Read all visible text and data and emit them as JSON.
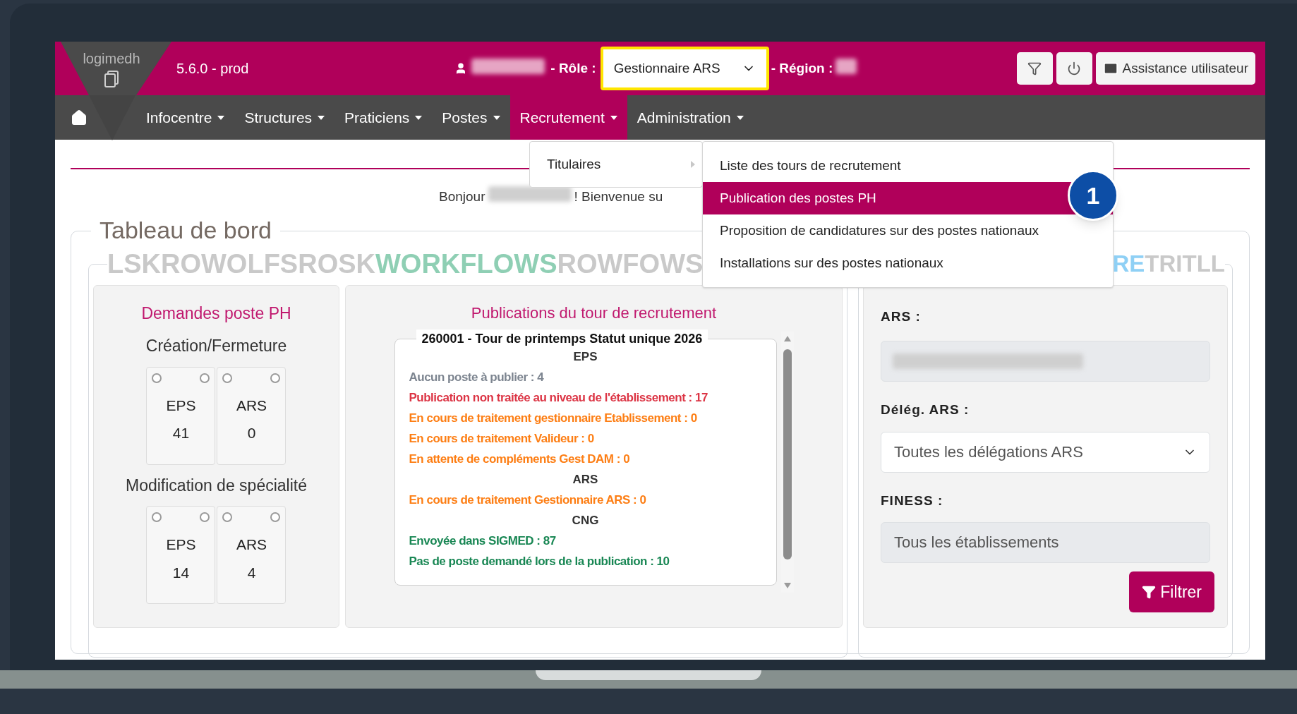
{
  "header": {
    "logo": "logimedh",
    "version": "5.6.0 - prod",
    "role_label": "- Rôle :",
    "role": "Gestionnaire ARS",
    "region_label": "- Région :",
    "support_button": "Assistance utilisateur"
  },
  "nav": [
    {
      "label": "Infocentre",
      "selected": false
    },
    {
      "label": "Structures",
      "selected": false
    },
    {
      "label": "Praticiens",
      "selected": false
    },
    {
      "label": "Postes",
      "selected": false
    },
    {
      "label": "Recrutement",
      "selected": true
    },
    {
      "label": "Administration",
      "selected": false
    }
  ],
  "menu": {
    "items": [
      {
        "label": "Titulaires"
      }
    ],
    "submenu": [
      {
        "label": "Liste des tours de recrutement",
        "selected": false
      },
      {
        "label": "Publication des postes PH",
        "selected": true
      },
      {
        "label": "Proposition de candidatures sur des postes nationaux",
        "selected": false
      },
      {
        "label": "Installations sur des postes nationaux",
        "selected": false
      }
    ]
  },
  "callout": "1",
  "greeting": {
    "before": "Bonjour",
    "after": "! Bienvenue su"
  },
  "dashboard": {
    "title": "Tableau de bord",
    "banner": [
      {
        "text": "LSKROWOLFSROSK",
        "color": "#c9c9c9"
      },
      {
        "text": "WORKFLOWS",
        "color": "#8fcfb4"
      },
      {
        "text": "ROWFOWS",
        "color": "#c9c9c9"
      }
    ],
    "banner_right": [
      {
        "text": "RE",
        "color": "#8fd0f5"
      },
      {
        "text": "TRITLL",
        "color": "#c9c9c9"
      }
    ]
  },
  "demandes": {
    "title": "Demandes poste PH",
    "groups": [
      {
        "title": "Création/Fermeture",
        "cards": [
          {
            "label": "EPS",
            "count": "41"
          },
          {
            "label": "ARS",
            "count": "0"
          }
        ]
      },
      {
        "title": "Modification de spécialité",
        "cards": [
          {
            "label": "EPS",
            "count": "14"
          },
          {
            "label": "ARS",
            "count": "4"
          }
        ]
      }
    ]
  },
  "publications": {
    "title": "Publications du tour de recrutement",
    "round": "260001 - Tour de printemps Statut unique 2026",
    "sections": [
      {
        "heading": "EPS",
        "lines": [
          {
            "text": "Aucun poste à publier :",
            "count": "4",
            "color": "#7d8590"
          },
          {
            "text": "Publication non traitée au niveau de l'établissement :",
            "count": "17",
            "color": "#dc3545"
          },
          {
            "text": "En cours de traitement gestionnaire Etablissement :",
            "count": "0",
            "color": "#fd7e14"
          },
          {
            "text": "En cours de traitement Valideur :",
            "count": "0",
            "color": "#fd7e14"
          },
          {
            "text": "En attente de compléments Gest DAM :",
            "count": "0",
            "color": "#fd7e14"
          }
        ]
      },
      {
        "heading": "ARS",
        "lines": [
          {
            "text": "En cours de traitement Gestionnaire ARS :",
            "count": "0",
            "color": "#fd7e14"
          }
        ]
      },
      {
        "heading": "CNG",
        "lines": [
          {
            "text": "Envoyée dans SIGMED :",
            "count": "87",
            "color": "#198754"
          },
          {
            "text": "Pas de poste demandé lors de la publication :",
            "count": "10",
            "color": "#198754"
          }
        ]
      }
    ]
  },
  "filters": {
    "ars_label": "ARS :",
    "deleg_label": "Délég. ARS :",
    "deleg_value": "Toutes les délégations ARS",
    "finess_label": "FINESS :",
    "finess_placeholder": "Tous les établissements",
    "button": "Filtrer"
  }
}
